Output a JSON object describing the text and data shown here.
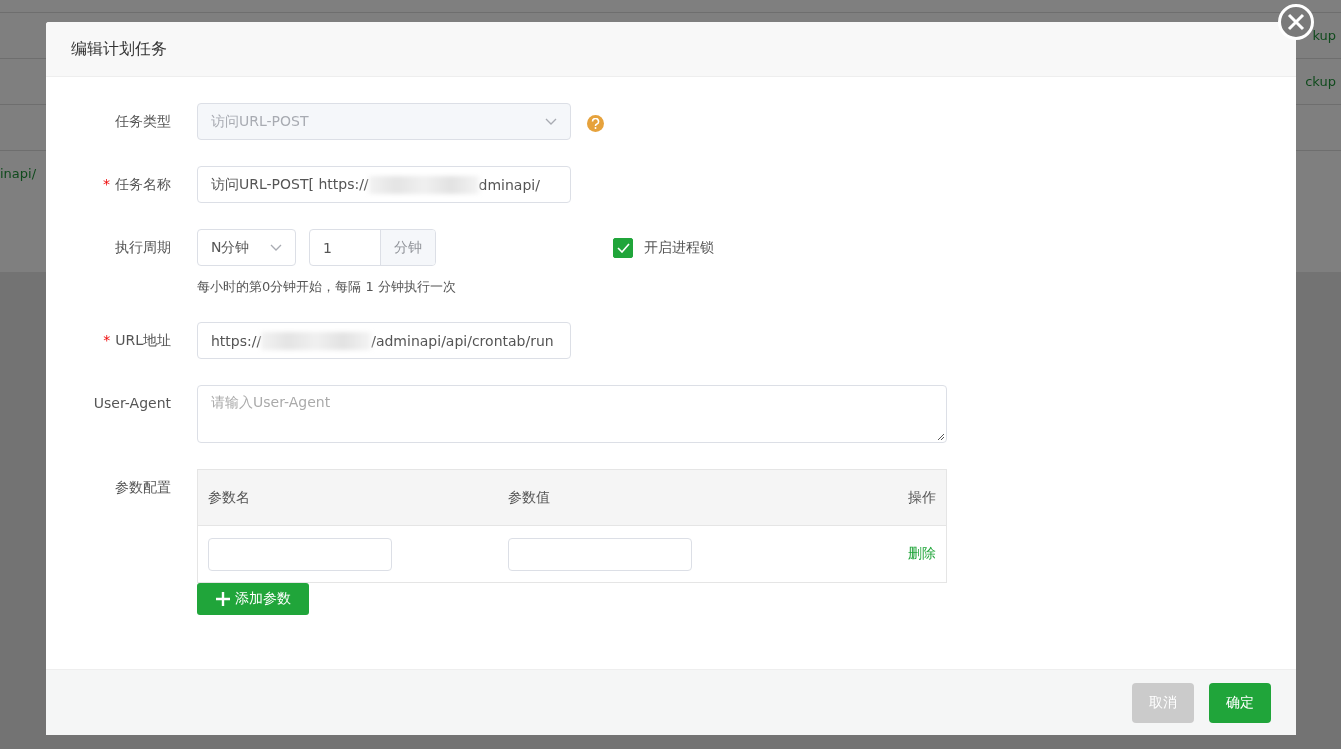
{
  "background_page": {
    "rows": [
      {
        "text": "kup"
      },
      {
        "text": "ckup"
      },
      {
        "text": ""
      },
      {
        "text": "inapi/"
      }
    ]
  },
  "dialog": {
    "title": "编辑计划任务",
    "fields": [
      {
        "kind": "select",
        "label": "任务类型",
        "value": "访问URL-POST",
        "disabled": true,
        "help": true
      },
      {
        "kind": "redacted",
        "label": "任务名称",
        "required_mark": "*",
        "value_before": "访问URL-POST[ https://",
        "value_after": "dminapi/"
      },
      {
        "kind": "period",
        "label": "执行周期",
        "unit_select": "N分钟",
        "number": "1",
        "number_unit": "分钟",
        "lock": {
          "label": "开启进程锁",
          "checked": true
        },
        "hint": "每小时的第0分钟开始，每隔 1 分钟执行一次"
      },
      {
        "kind": "redacted",
        "label": "URL地址",
        "required_mark": "*",
        "value_before": "https://",
        "value_after": "/adminapi/api/crontab/run"
      },
      {
        "kind": "textarea",
        "label": "User-Agent",
        "placeholder": "请输入User-Agent"
      },
      {
        "kind": "params",
        "label": "参数配置",
        "columns": [
          "参数名",
          "参数值",
          "操作"
        ],
        "rows": [
          {
            "name": "",
            "value": "",
            "action": "删除"
          }
        ],
        "add_button": "添加参数"
      }
    ],
    "buttons": [
      {
        "label": "取消",
        "kind": "secondary"
      },
      {
        "label": "确定",
        "kind": "primary"
      }
    ]
  }
}
